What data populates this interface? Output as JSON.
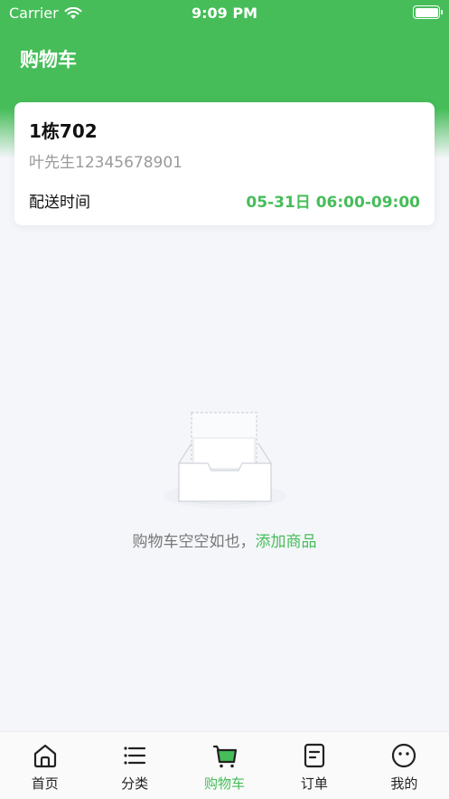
{
  "status_bar": {
    "carrier": "Carrier",
    "time": "9:09 PM"
  },
  "header": {
    "title": "购物车"
  },
  "address": {
    "title": "1栋702",
    "contact": "叶先生12345678901",
    "delivery_label": "配送时间",
    "delivery_time": "05-31日 06:00-09:00"
  },
  "empty": {
    "message": "购物车空空如也，",
    "link": "添加商品"
  },
  "tabbar": {
    "items": [
      {
        "label": "首页",
        "icon": "home-icon"
      },
      {
        "label": "分类",
        "icon": "list-icon"
      },
      {
        "label": "购物车",
        "icon": "cart-icon",
        "active": true
      },
      {
        "label": "订单",
        "icon": "order-icon"
      },
      {
        "label": "我的",
        "icon": "profile-face-icon"
      }
    ]
  },
  "colors": {
    "accent": "#46bd59",
    "background": "#f5f6fa",
    "text_secondary": "#9a9a9a"
  }
}
